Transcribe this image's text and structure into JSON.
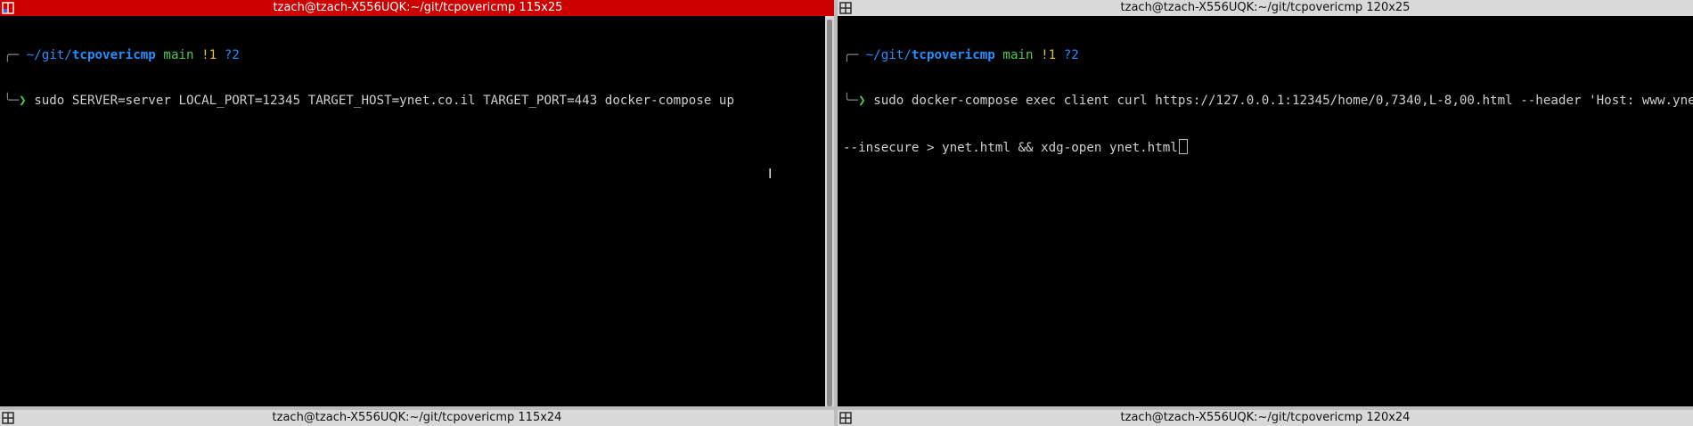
{
  "colors": {
    "active_titlebar": "#cc0000",
    "inactive_titlebar": "#d9d9d9",
    "terminal_bg": "#000000",
    "path_blue": "#1e90ff",
    "branch_green": "#4ec94e",
    "modified_yellow": "#e0c030"
  },
  "panes": {
    "top_left": {
      "title": "tzach@tzach-X556UQK:~/git/tcpovericmp 115x25",
      "icon": "split-icon",
      "prompt": {
        "frame_top": "╭─",
        "path_prefix": "~/git/",
        "path_repo": "tcpovericmp",
        "branch": "main",
        "modified": "!1",
        "untracked": "?2",
        "frame_bottom": "╰─",
        "arrow": "❯"
      },
      "command": "sudo SERVER=server LOCAL_PORT=12345 TARGET_HOST=ynet.co.il TARGET_PORT=443 docker-compose up"
    },
    "top_right": {
      "title": "tzach@tzach-X556UQK:~/git/tcpovericmp 120x25",
      "icon": "split-icon",
      "prompt": {
        "frame_top": "╭─",
        "path_prefix": "~/git/",
        "path_repo": "tcpovericmp",
        "branch": "main",
        "modified": "!1",
        "untracked": "?2",
        "frame_bottom": "╰─",
        "arrow": "❯"
      },
      "command_line1": "sudo docker-compose exec client curl https://127.0.0.1:12345/home/0,7340,L-8,00.html --header 'Host: www.ynet.co.il'",
      "command_line2": "--insecure > ynet.html && xdg-open ynet.html"
    },
    "bottom_left": {
      "title": "tzach@tzach-X556UQK:~/git/tcpovericmp 115x24",
      "icon": "split-icon"
    },
    "bottom_right": {
      "title": "tzach@tzach-X556UQK:~/git/tcpovericmp 120x24",
      "icon": "split-icon"
    }
  },
  "mouse_cursor": "text-ibeam-cursor"
}
